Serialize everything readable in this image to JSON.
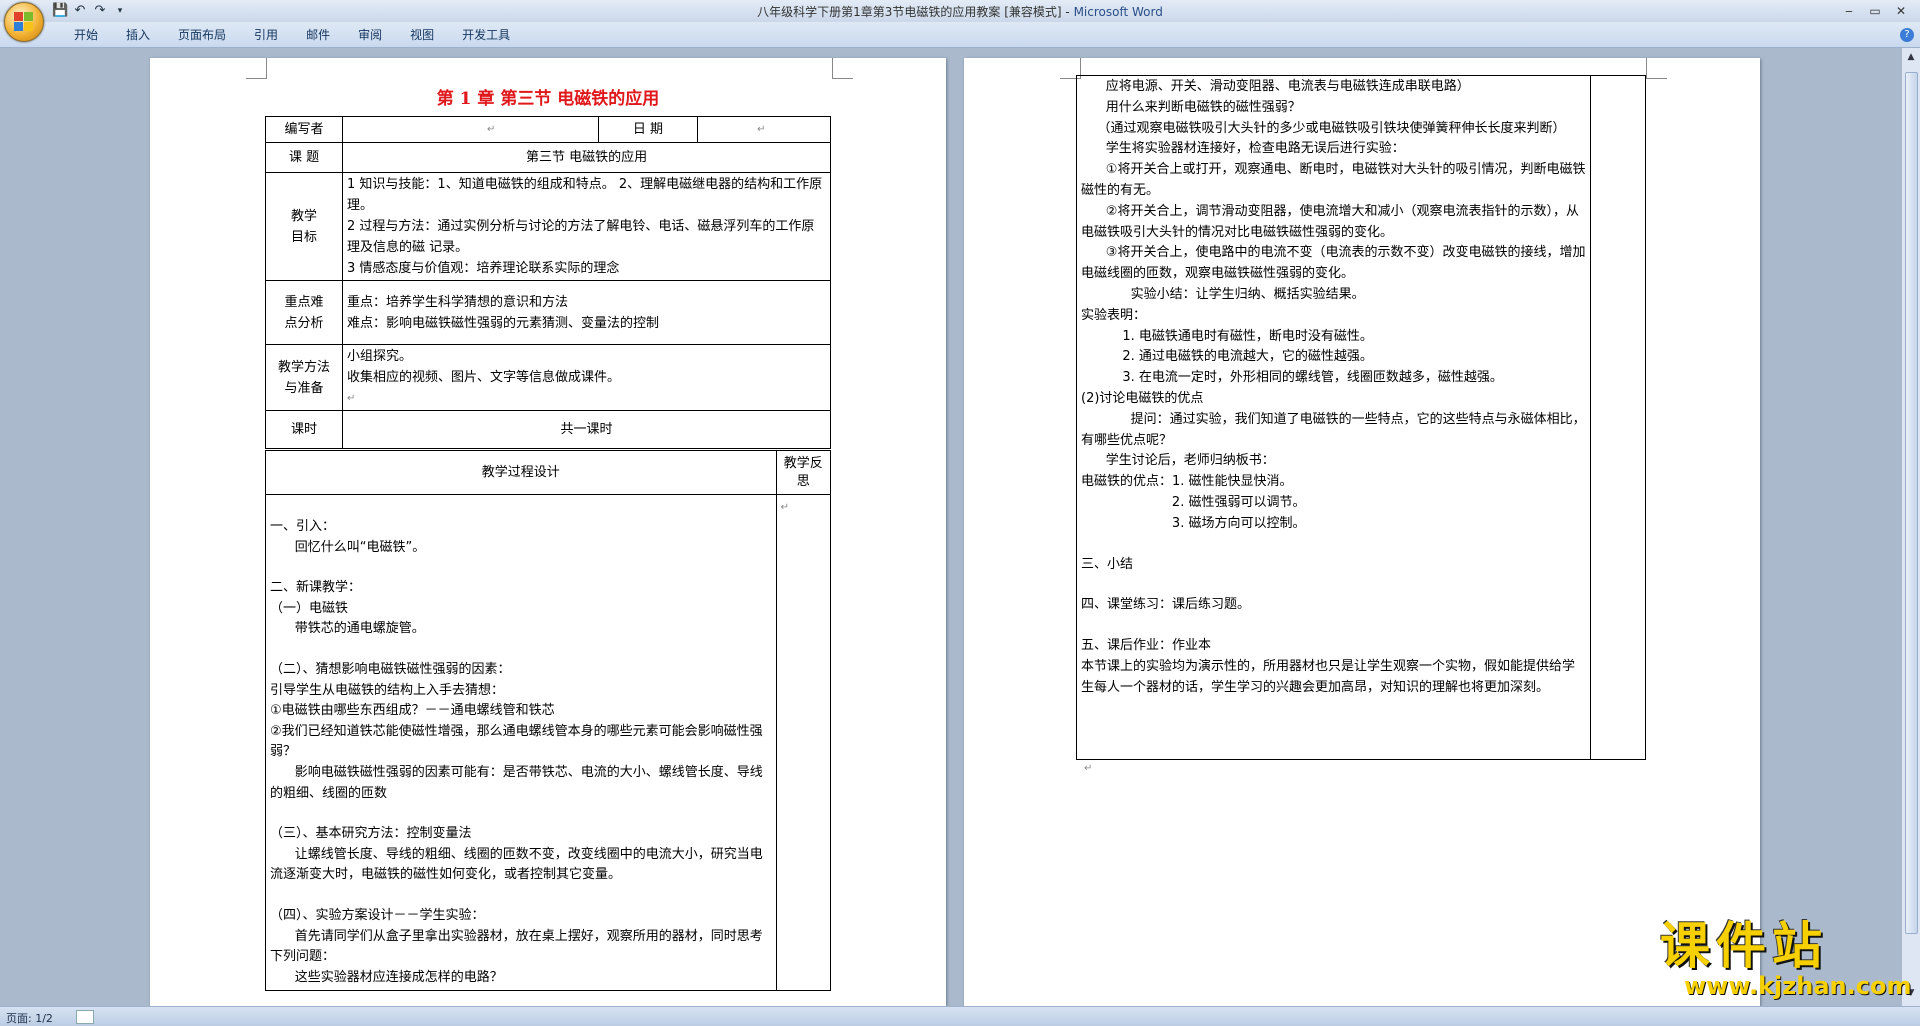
{
  "window": {
    "title": "八年级科学下册第1章第3节电磁铁的应用教案 [兼容模式] - ",
    "app_name": "Microsoft Word",
    "controls": [
      "‒",
      "▭",
      "✕"
    ]
  },
  "ribbon": {
    "tabs": [
      "开始",
      "插入",
      "页面布局",
      "引用",
      "邮件",
      "审阅",
      "视图",
      "开发工具"
    ]
  },
  "status": {
    "page": "页面: 1/2"
  },
  "watermark": {
    "title": "课件站",
    "url": "www.kjzhan.com"
  },
  "page1": {
    "title": "第 1 章  第三节  电磁铁的应用",
    "author_label": "编写者",
    "date_label": "日  期",
    "topic_label": "课    题",
    "topic_value": "第三节    电磁铁的应用",
    "goals_label": "教学目标",
    "goals": [
      "1 知识与技能：1、知道电磁铁的组成和特点。   2、理解电磁继电器的结构和工作原理。",
      "2 过程与方法：通过实例分析与讨论的方法了解电铃、电话、磁悬浮列车的工作原理及信息的磁 记录。",
      "3 情感态度与价值观：培养理论联系实际的理念"
    ],
    "keypoints_label": "重点难点分析",
    "keypoints": [
      "重点：培养学生科学猜想的意识和方法",
      "难点：影响电磁铁磁性强弱的元素猜测、变量法的控制"
    ],
    "method_label": "教学方法与准备",
    "methods": [
      "小组探究。",
      "收集相应的视频、图片、文字等信息做成课件。"
    ],
    "hours_label": "课时",
    "hours_value": "共一课时",
    "process_label": "教学过程设计",
    "reflection_label": "教学反思",
    "body": [
      "",
      "一、引入：",
      "      回忆什么叫“电磁铁”。",
      "",
      "二、新课教学：",
      "（一）电磁铁",
      "      带铁芯的通电螺旋管。",
      "",
      "（二）、猜想影响电磁铁磁性强弱的因素：",
      "引导学生从电磁铁的结构上入手去猜想：",
      "①电磁铁由哪些东西组成？－－通电螺线管和铁芯",
      "②我们已经知道铁芯能使磁性增强，那么通电螺线管本身的哪些元素可能会影响磁性强弱？",
      "      影响电磁铁磁性强弱的因素可能有：是否带铁芯、电流的大小、螺线管长度、导线的粗细、线圈的匝数",
      "",
      "（三）、基本研究方法：控制变量法",
      "      让螺线管长度、导线的粗细、线圈的匝数不变，改变线圈中的电流大小，研究当电流逐渐变大时，电磁铁的磁性如何变化，或者控制其它变量。",
      "",
      "（四）、实验方案设计－－学生实验：",
      "      首先请同学们从盒子里拿出实验器材，放在桌上摆好，观察所用的器材，同时思考下列问题：",
      "      这些实验器材应连接成怎样的电路？"
    ]
  },
  "page2": {
    "body": [
      "      应将电源、开关、滑动变阻器、电流表与电磁铁连成串联电路）",
      "      用什么来判断电磁铁的磁性强弱？",
      "    （通过观察电磁铁吸引大头针的多少或电磁铁吸引铁块使弹簧秤伸长长度来判断）",
      "      学生将实验器材连接好，检查电路无误后进行实验：",
      "      ①将开关合上或打开，观察通电、断电时，电磁铁对大头针的吸引情况，判断电磁铁磁性的有无。",
      "      ②将开关合上，调节滑动变阻器，使电流增大和减小（观察电流表指针的示数），从电磁铁吸引大头针的情况对比电磁铁磁性强弱的变化。",
      "      ③将开关合上，使电路中的电流不变（电流表的示数不变）改变电磁铁的接线，增加电磁线圈的匝数，观察电磁铁磁性强弱的变化。",
      "            实验小结：让学生归纳、概括实验结果。",
      "实验表明：",
      "          1. 电磁铁通电时有磁性，断电时没有磁性。",
      "          2. 通过电磁铁的电流越大，它的磁性越强。",
      "          3. 在电流一定时，外形相同的螺线管，线圈匝数越多，磁性越强。",
      "(2)讨论电磁铁的优点",
      "            提问：通过实验，我们知道了电磁铁的一些特点，它的这些特点与永磁体相比，有哪些优点呢？",
      "      学生讨论后，老师归纳板书：",
      "电磁铁的优点：1. 磁性能快显快消。",
      "                      2. 磁性强弱可以调节。",
      "                      3. 磁场方向可以控制。",
      "",
      "三、小结",
      "",
      "四、课堂练习：课后练习题。",
      "",
      "五、课后作业：作业本",
      "本节课上的实验均为演示性的，所用器材也只是让学生观察一个实物，假如能提供给学生每人一个器材的话，学生学习的兴趣会更加高昂，对知识的理解也将更加深刻。"
    ]
  }
}
